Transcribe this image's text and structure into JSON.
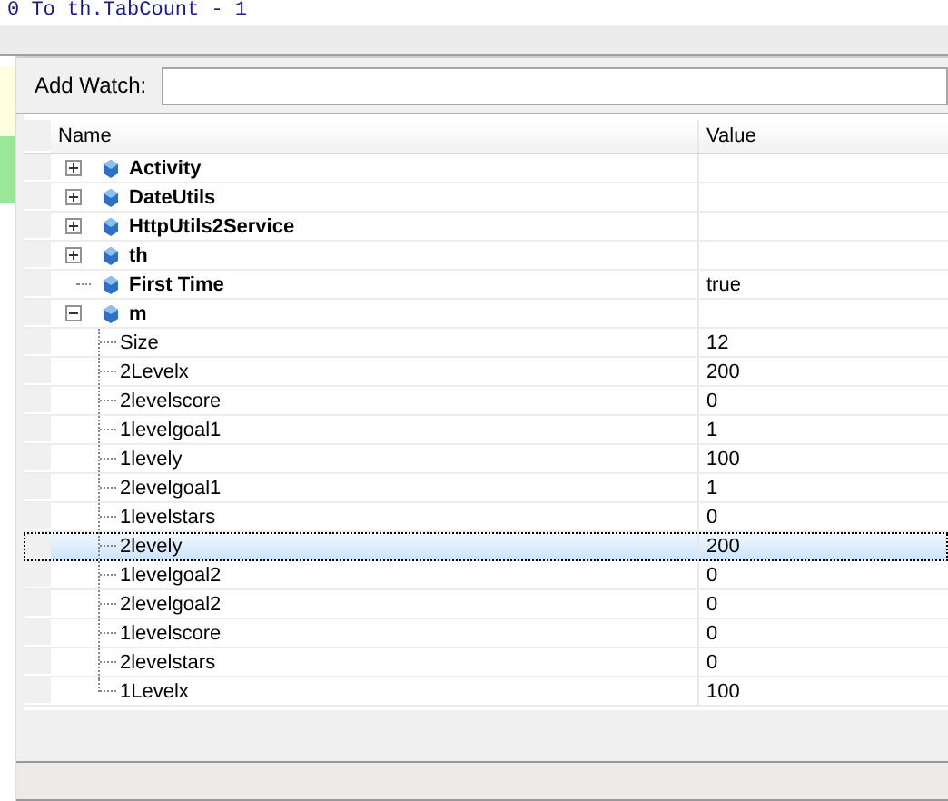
{
  "code_line": "0 To th.TabCount - 1",
  "add_watch": {
    "label": "Add Watch:"
  },
  "columns": [
    "Name",
    "Value"
  ],
  "rows": [
    {
      "name": "Activity",
      "kind": "object",
      "expanded": false,
      "selected": false
    },
    {
      "name": "DateUtils",
      "kind": "object",
      "expanded": false,
      "selected": false
    },
    {
      "name": "HttpUtils2Service",
      "kind": "object",
      "expanded": false,
      "selected": false
    },
    {
      "name": "th",
      "kind": "object",
      "expanded": false,
      "selected": false
    },
    {
      "name": "First Time",
      "value": "true",
      "kind": "value",
      "selected": false
    },
    {
      "name": "m",
      "kind": "object",
      "expanded": true,
      "selected": false,
      "children": [
        {
          "name": "Size",
          "value": "12",
          "selected": false
        },
        {
          "name": "2Levelx",
          "value": "200",
          "selected": false
        },
        {
          "name": "2levelscore",
          "value": "0",
          "selected": false
        },
        {
          "name": "1levelgoal1",
          "value": "1",
          "selected": false
        },
        {
          "name": "1levely",
          "value": "100",
          "selected": false
        },
        {
          "name": "2levelgoal1",
          "value": "1",
          "selected": false
        },
        {
          "name": "1levelstars",
          "value": "0",
          "selected": false
        },
        {
          "name": "2levely",
          "value": "200",
          "selected": true
        },
        {
          "name": "1levelgoal2",
          "value": "0",
          "selected": false
        },
        {
          "name": "2levelgoal2",
          "value": "0",
          "selected": false
        },
        {
          "name": "1levelscore",
          "value": "0",
          "selected": false
        },
        {
          "name": "2levelstars",
          "value": "0",
          "selected": false
        },
        {
          "name": "1Levelx",
          "value": "100",
          "selected": false
        }
      ]
    }
  ]
}
